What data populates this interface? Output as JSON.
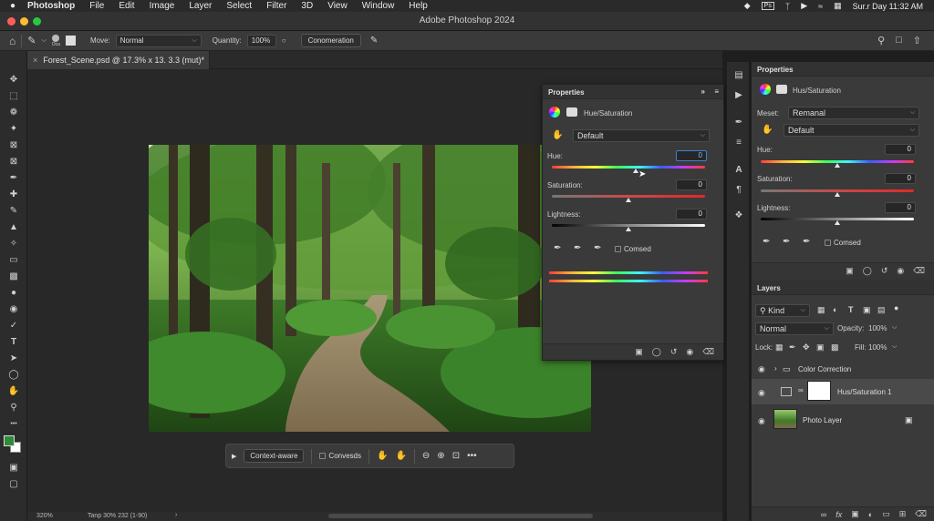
{
  "menubar": {
    "app_name": "Photoshop",
    "items": [
      "File",
      "Edit",
      "Image",
      "Layer",
      "Select",
      "Filter",
      "3D",
      "View",
      "Window",
      "Help"
    ],
    "clock": "Sur.r Day 11:32 AM"
  },
  "window": {
    "title": "Adobe Photoshop 2024"
  },
  "options_bar": {
    "brush_size_label": "Oca",
    "move_label": "Move:",
    "move_value": "Normal",
    "quantity_label": "Quantity:",
    "quantity_value": "100%",
    "action_button": "Conomeration"
  },
  "document": {
    "tab_label": "Forest_Scene.psd @ 17.3% x 13. 3.3 (mut)*",
    "close_glyph": "×"
  },
  "status": {
    "zoom": "320%",
    "info": "Tanp 30% 232 (1-90)"
  },
  "context_bar": {
    "primary_button": "Context-aware",
    "checkbox_label": "Convesds"
  },
  "float_props": {
    "panel_title": "Properties",
    "adjustment_title": "Hue/Saturation",
    "preset_value": "Default",
    "hue_label": "Hue:",
    "hue_value": "0",
    "hue_level": 0.55,
    "saturation_label": "Saturation:",
    "saturation_value": "0",
    "saturation_level": 0.5,
    "lightness_label": "Lightness:",
    "lightness_value": "0",
    "lightness_level": 0.5,
    "colorize_label": "Comsed"
  },
  "dock_props": {
    "panel_title": "Properties",
    "adjustment_title": "Hus/Saturation",
    "meset_label": "Meset:",
    "meset_value": "Remanal",
    "preset_value": "Default",
    "hue_label": "Hue:",
    "hue_value": "0",
    "hue_level": 0.5,
    "saturation_label": "Saturation:",
    "saturation_value": "0",
    "saturation_level": 0.5,
    "lightness_label": "Lightness:",
    "lightness_value": "0",
    "lightness_level": 0.5,
    "colorize_label": "Comsed"
  },
  "layers": {
    "panel_title": "Layers",
    "filter_value": "Kind",
    "blend_mode": "Normal",
    "opacity_label": "Opacity:",
    "opacity_value": "100%",
    "lock_label": "Lock:",
    "fill_label": "Fill:",
    "fill_value": "100%",
    "items": [
      {
        "name": "Color Correction"
      },
      {
        "name": "Hus/Saturation 1"
      },
      {
        "name": "Photo Layer"
      }
    ]
  },
  "colors": {
    "foreground": "#2f8a3a",
    "background": "#ffffff",
    "focus_accent": "#3d7fd8"
  }
}
